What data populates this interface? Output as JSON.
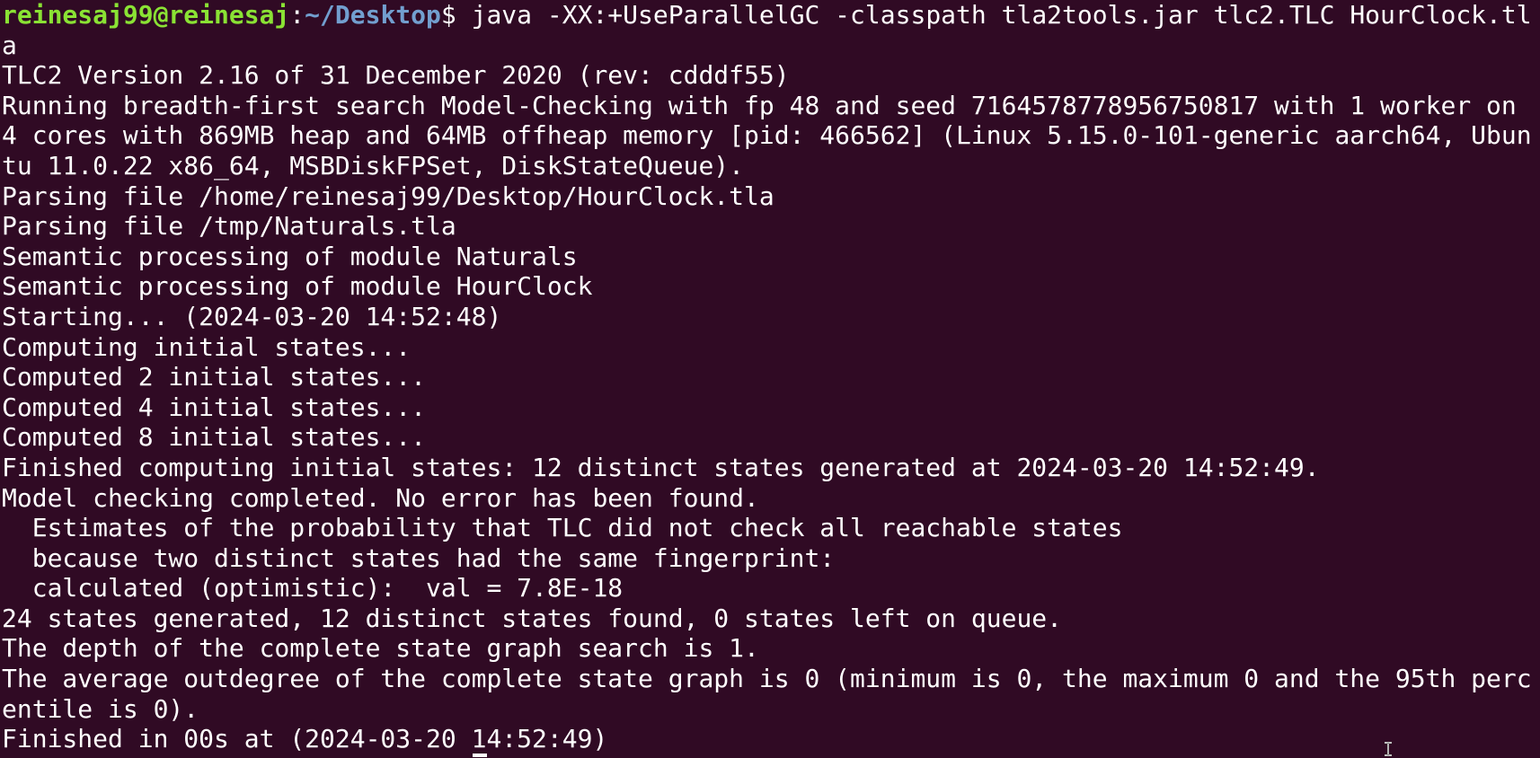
{
  "prompt": {
    "user_host": "reinesaj99@reinesaj",
    "separator": ":",
    "path": "~/Desktop",
    "symbol": "$ ",
    "command": "java -XX:+UseParallelGC -classpath tla2tools.jar tlc2.TLC HourClock.tl"
  },
  "output": [
    "a",
    "TLC2 Version 2.16 of 31 December 2020 (rev: cdddf55)",
    "Running breadth-first search Model-Checking with fp 48 and seed 7164578778956750817 with 1 worker on",
    "4 cores with 869MB heap and 64MB offheap memory [pid: 466562] (Linux 5.15.0-101-generic aarch64, Ubun",
    "tu 11.0.22 x86_64, MSBDiskFPSet, DiskStateQueue).",
    "Parsing file /home/reinesaj99/Desktop/HourClock.tla",
    "Parsing file /tmp/Naturals.tla",
    "Semantic processing of module Naturals",
    "Semantic processing of module HourClock",
    "Starting... (2024-03-20 14:52:48)",
    "Computing initial states...",
    "Computed 2 initial states...",
    "Computed 4 initial states...",
    "Computed 8 initial states...",
    "Finished computing initial states: 12 distinct states generated at 2024-03-20 14:52:49.",
    "Model checking completed. No error has been found.",
    "  Estimates of the probability that TLC did not check all reachable states",
    "  because two distinct states had the same fingerprint:",
    "  calculated (optimistic):  val = 7.8E-18",
    "24 states generated, 12 distinct states found, 0 states left on queue.",
    "The depth of the complete state graph search is 1.",
    "The average outdegree of the complete state graph is 0 (minimum is 0, the maximum 0 and the 95th perc",
    "entile is 0).",
    "Finished in 00s at (2024-03-20 14:52:49)"
  ],
  "icons": {
    "cursor": "text-cursor-icon",
    "pointer": "ibeam-pointer-icon"
  },
  "colors": {
    "background": "#300a24",
    "text": "#ffffff",
    "user_host": "#8ae234",
    "path": "#729fcf"
  }
}
